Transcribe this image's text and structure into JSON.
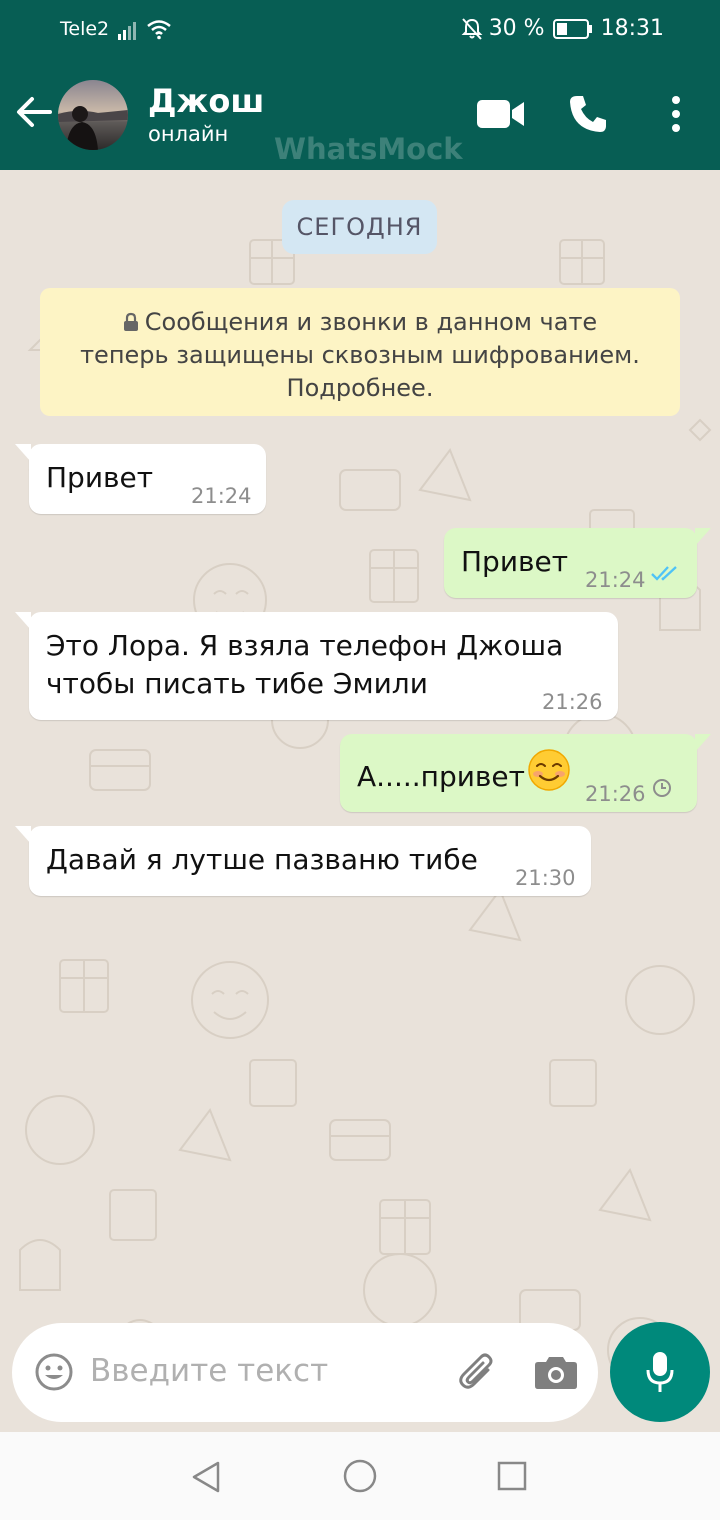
{
  "status_bar": {
    "carrier": "Tele2",
    "battery_text": "30 %",
    "time": "18:31"
  },
  "header": {
    "contact_name": "Джош",
    "contact_status": "онлайн",
    "watermark": "WhatsMock"
  },
  "chat": {
    "date_label": "СЕГОДНЯ",
    "encryption_notice": {
      "line1": "Сообщения и звонки в данном чате",
      "line2": "теперь защищены сквозным шифрованием.",
      "line3": "Подробнее."
    },
    "messages": [
      {
        "direction": "incoming",
        "text": "Привет",
        "time": "21:24"
      },
      {
        "direction": "outgoing",
        "text": "Привет",
        "time": "21:24",
        "status": "read"
      },
      {
        "direction": "incoming",
        "line1": "Это Лора. Я взяла телефон Джоша",
        "line2": "чтобы писать тибе Эмили",
        "time": "21:26"
      },
      {
        "direction": "outgoing",
        "text": "А.....привет",
        "emoji": "smiling-face",
        "time": "21:26",
        "status": "pending"
      },
      {
        "direction": "incoming",
        "text": "Давай я лутше пазваню тибе",
        "time": "21:30"
      }
    ]
  },
  "input": {
    "placeholder": "Введите текст"
  },
  "colors": {
    "header": "#075e54",
    "outgoing_bubble": "#dcf8c6",
    "incoming_bubble": "#ffffff",
    "mic_button": "#00897b",
    "date_chip": "#d4e7f3",
    "notice": "#fdf4c5",
    "read_ticks": "#4fc3f7"
  }
}
